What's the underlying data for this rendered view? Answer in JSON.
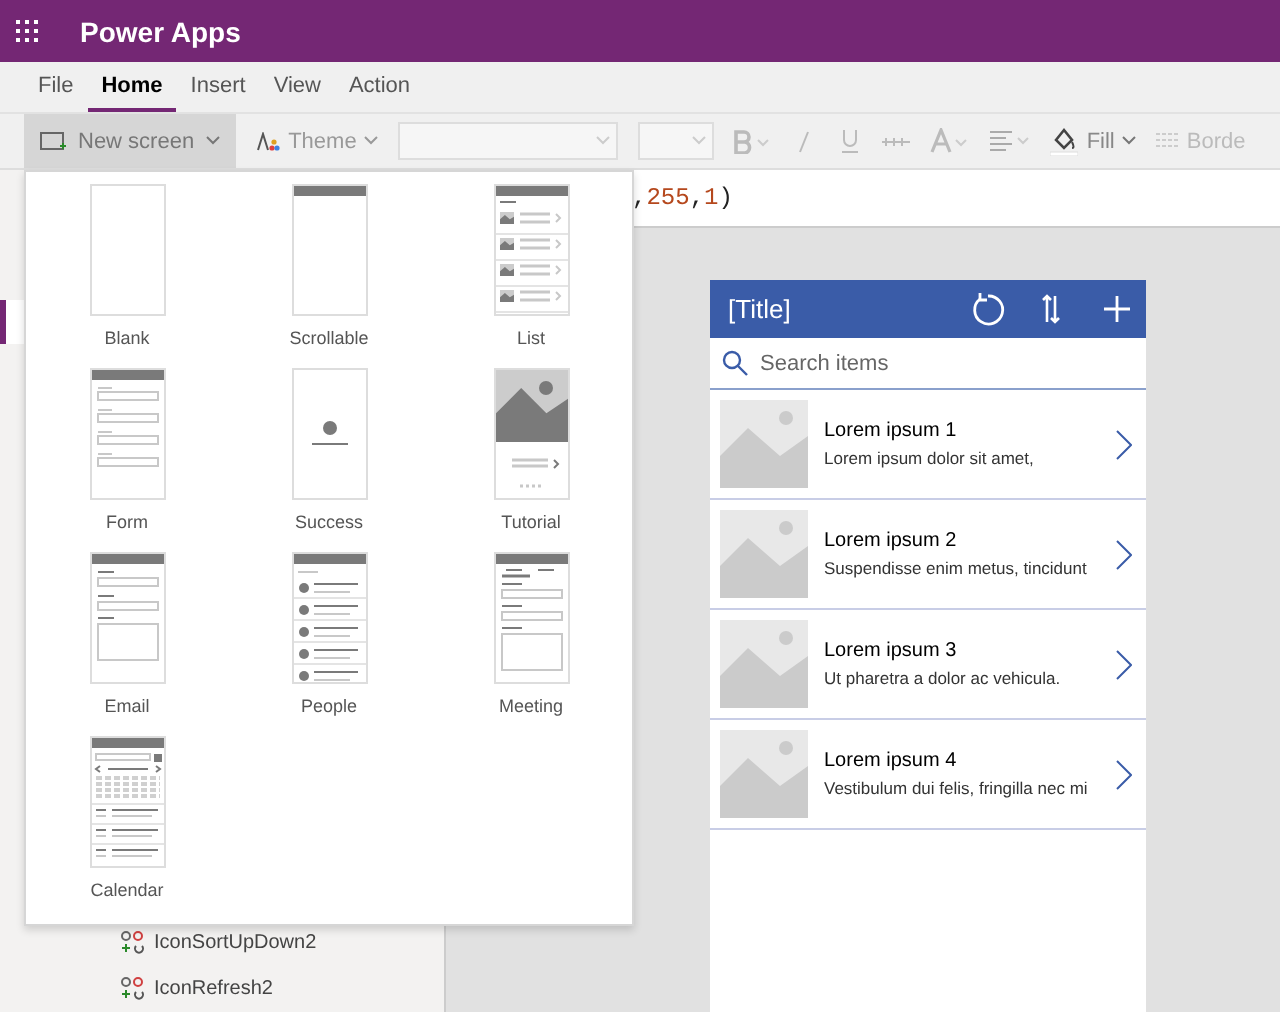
{
  "app_bar": {
    "title": "Power Apps"
  },
  "menu_tabs": [
    {
      "label": "File",
      "selected": false
    },
    {
      "label": "Home",
      "selected": true
    },
    {
      "label": "Insert",
      "selected": false
    },
    {
      "label": "View",
      "selected": false
    },
    {
      "label": "Action",
      "selected": false
    }
  ],
  "toolbar": {
    "new_screen": {
      "label": "New screen",
      "expanded": true
    },
    "theme": {
      "label": "Theme"
    },
    "fill": {
      "label": "Fill"
    },
    "border": {
      "label": "Borde"
    }
  },
  "formula": [
    {
      "kind": "punct",
      "text": ","
    },
    {
      "kind": "number",
      "text": "255"
    },
    {
      "kind": "punct",
      "text": ","
    },
    {
      "kind": "number",
      "text": "1"
    },
    {
      "kind": "punct",
      "text": ")"
    }
  ],
  "new_screen_menu": [
    {
      "kind": "blank",
      "label": "Blank"
    },
    {
      "kind": "scrollable",
      "label": "Scrollable"
    },
    {
      "kind": "list",
      "label": "List"
    },
    {
      "kind": "form",
      "label": "Form"
    },
    {
      "kind": "success",
      "label": "Success"
    },
    {
      "kind": "tutorial",
      "label": "Tutorial"
    },
    {
      "kind": "email",
      "label": "Email"
    },
    {
      "kind": "people",
      "label": "People"
    },
    {
      "kind": "meeting",
      "label": "Meeting"
    },
    {
      "kind": "calendar",
      "label": "Calendar"
    }
  ],
  "tree_items": [
    {
      "label": "IconSortUpDown2"
    },
    {
      "label": "IconRefresh2"
    }
  ],
  "phone": {
    "title": "[Title]",
    "search": {
      "placeholder": "Search items"
    },
    "items": [
      {
        "title": "Lorem ipsum 1",
        "subtitle": "Lorem ipsum dolor sit amet,"
      },
      {
        "title": "Lorem ipsum 2",
        "subtitle": "Suspendisse enim metus, tincidunt"
      },
      {
        "title": "Lorem ipsum 3",
        "subtitle": "Ut pharetra a dolor ac vehicula."
      },
      {
        "title": "Lorem ipsum 4",
        "subtitle": "Vestibulum dui felis, fringilla nec mi"
      }
    ]
  }
}
